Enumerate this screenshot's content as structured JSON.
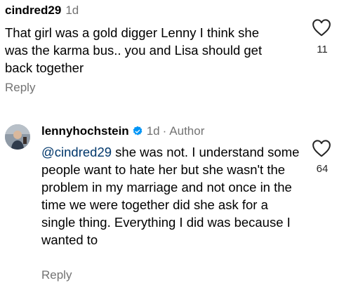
{
  "comments": [
    {
      "username": "cindred29",
      "timestamp": "1d",
      "text": "That girl was a gold digger Lenny I think she was the karma bus.. you and Lisa should get back together",
      "likes": "11",
      "reply_label": "Reply",
      "like_icon": "heart-outline-icon"
    },
    {
      "username": "lennyhochstein",
      "verified": true,
      "timestamp": "1d",
      "separator": "·",
      "role": "Author",
      "mention": "@cindred29",
      "text": " she was not. I understand some people want to hate her but she wasn't the problem in my marriage and not once in the time we were together did she ask for a single thing. Everything I did was because I wanted to",
      "likes": "64",
      "reply_label": "Reply",
      "like_icon": "heart-outline-icon"
    }
  ],
  "colors": {
    "text": "#000000",
    "secondary": "#737373",
    "mention": "#00376b",
    "verified": "#0095f6"
  }
}
